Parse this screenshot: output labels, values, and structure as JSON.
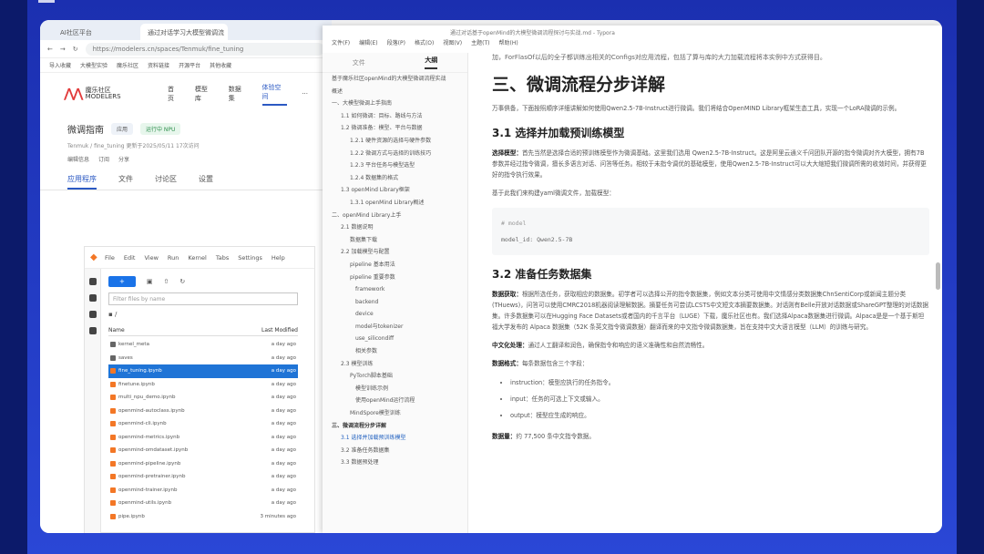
{
  "browser": {
    "tabs": [
      "AI社区平台",
      "通过对话学习大模型微调流"
    ],
    "url": "https://modelers.cn/spaces/Tenmuk/fine_tuning",
    "bookmarks": [
      "导入收藏",
      "大模型实验",
      "魔乐社区",
      "资料链接",
      "开源平台",
      "其他收藏"
    ]
  },
  "site": {
    "logo_text": "魔乐社区 MODELERS",
    "nav": [
      "首页",
      "模型库",
      "数据集",
      "体验空间",
      "···"
    ],
    "space": {
      "title": "微调指南",
      "tags": [
        "应用",
        "运行中 NPU"
      ],
      "meta": "Tenmuk / fine_tuning   更新于2025/05/11   17次访问",
      "tools": [
        "编辑信息",
        "订阅",
        "分享"
      ]
    },
    "subnav": [
      "应用程序",
      "文件",
      "讨论区",
      "设置"
    ]
  },
  "jupyter": {
    "menu": [
      "File",
      "Edit",
      "View",
      "Run",
      "Kernel",
      "Tabs",
      "Settings",
      "Help"
    ],
    "new_button": "+",
    "filter_placeholder": "Filter files by name",
    "path": "/",
    "col_name": "Name",
    "col_modified": "Last Modified",
    "files": [
      {
        "name": "kernel_meta",
        "time": "a day ago",
        "type": "folder"
      },
      {
        "name": "saves",
        "time": "a day ago",
        "type": "folder"
      },
      {
        "name": "fine_tuning.ipynb",
        "time": "a day ago",
        "type": "nb"
      },
      {
        "name": "finetune.ipynb",
        "time": "a day ago",
        "type": "nb"
      },
      {
        "name": "multi_npu_demo.ipynb",
        "time": "a day ago",
        "type": "nb"
      },
      {
        "name": "openmind-autoclass.ipynb",
        "time": "a day ago",
        "type": "nb"
      },
      {
        "name": "openmind-cli.ipynb",
        "time": "a day ago",
        "type": "nb"
      },
      {
        "name": "openmind-metrics.ipynb",
        "time": "a day ago",
        "type": "nb"
      },
      {
        "name": "openmind-omdataset.ipynb",
        "time": "a day ago",
        "type": "nb"
      },
      {
        "name": "openmind-pipeline.ipynb",
        "time": "a day ago",
        "type": "nb"
      },
      {
        "name": "openmind-pretrainer.ipynb",
        "time": "a day ago",
        "type": "nb"
      },
      {
        "name": "openmind-trainer.ipynb",
        "time": "a day ago",
        "type": "nb"
      },
      {
        "name": "openmind-utils.ipynb",
        "time": "a day ago",
        "type": "nb"
      },
      {
        "name": "pipe.ipynb",
        "time": "3 minutes ago",
        "type": "nb"
      }
    ]
  },
  "typora": {
    "title": "通过对话基于openMind的大模型微调流程探讨与实战.md - Typora",
    "menu": [
      "文件(F)",
      "编辑(E)",
      "段落(P)",
      "格式(O)",
      "视图(V)",
      "主题(T)",
      "帮助(H)"
    ],
    "outline_tabs": [
      "文件",
      "大纲"
    ],
    "outline": [
      {
        "t": "基于魔乐社区openMind的大模型微调流程实战",
        "l": "l1"
      },
      {
        "t": "概述",
        "l": "l1"
      },
      {
        "t": "一、大模型微调上手指南",
        "l": "l1"
      },
      {
        "t": "1.1 如何微调：目标、路线与方法",
        "l": "l2"
      },
      {
        "t": "1.2 微调准备：模型、平台与数据",
        "l": "l2"
      },
      {
        "t": "1.2.1 硬件资源的选择与硬件参数",
        "l": "l3"
      },
      {
        "t": "1.2.2 微调方式与选择的训练技巧",
        "l": "l3"
      },
      {
        "t": "1.2.3 平台任务与模型选型",
        "l": "l3"
      },
      {
        "t": "1.2.4 数据集的格式",
        "l": "l3"
      },
      {
        "t": "1.3 openMind Library框架",
        "l": "l2"
      },
      {
        "t": "1.3.1 openMind Library概述",
        "l": "l3"
      },
      {
        "t": "二、openMind Library上手",
        "l": "l1"
      },
      {
        "t": "2.1 数据说明",
        "l": "l2"
      },
      {
        "t": "数据集下载",
        "l": "l3"
      },
      {
        "t": "2.2 加载模型与配置",
        "l": "l2"
      },
      {
        "t": "pipeline 基本用法",
        "l": "l3"
      },
      {
        "t": "pipeline 重要参数",
        "l": "l3"
      },
      {
        "t": "framework",
        "l": "l4"
      },
      {
        "t": "backend",
        "l": "l4"
      },
      {
        "t": "device",
        "l": "l4"
      },
      {
        "t": "model与tokenizer",
        "l": "l4"
      },
      {
        "t": "use_silicondiff",
        "l": "l4"
      },
      {
        "t": "相关参数",
        "l": "l4"
      },
      {
        "t": "2.3 模型训练",
        "l": "l2"
      },
      {
        "t": "PyTorch脚本基础",
        "l": "l3"
      },
      {
        "t": "模型训练示例",
        "l": "l4"
      },
      {
        "t": "使用openMind运行流程",
        "l": "l4"
      },
      {
        "t": "MindSpore模型训练",
        "l": "l3"
      },
      {
        "t": "三、微调流程分步详解",
        "l": "l1 bold"
      },
      {
        "t": "3.1 选择并加载预训练模型",
        "l": "l2 cur"
      },
      {
        "t": "3.2 准备任务数据集",
        "l": "l2"
      },
      {
        "t": "3.3 数据预处理",
        "l": "l2"
      }
    ],
    "doc": {
      "topline": "加，ForFlasOf以后的全子都训练出相关的Configs对应用流程，包括了算与库的大力加载流程将本实例中方式获得目。",
      "h2": "三、微调流程分步详解",
      "p1": "万事俱备，下面按照顺序详细讲解如何使用Qwen2.5-7B-Instruct进行微调。我们将结合OpenMIND Library框架生态工具，实现一个LoRA微调的示例。",
      "h3_1": "3.1 选择并加载预训练模型",
      "p2_label": "选择模型：",
      "p2": "首先当然是选择合适的预训练模型作为微调基础。这里我们选用 Qwen2.5-7B-Instruct。这是阿里云通义千问团队开源的指令微调对齐大模型，拥有7B参数并经过指令微调，擅长多语言对话、问答等任务。相较于未指令调优的基础模型，使用Qwen2.5-7B-Instruct可以大大缩短我们微调所需的收敛时间，并获得更好的指令执行效果。",
      "p3": "基于此我们来构建yaml微调文件，加载模型：",
      "code_comment": "# model",
      "code_line": "model_id: Qwen2.5-7B",
      "h3_2": "3.2 准备任务数据集",
      "p4_label": "数据获取：",
      "p4": "根据所选任务，获取相应的数据集。初学者可以选择公开的指令数据集，例如文本分类可使用中文情感分类数据集ChnSentiCorp或新闻主题分类(THuews)，问答可以使用CMRC2018机器阅读理解数据。摘要任务可尝试LCSTS中文短文本摘要数据集。对话则有Belle开放对话数据或ShareGPT整理的对话数据集。许多数据集可以在Hugging Face Datasets或者国内的千言平台（LUGE）下载，魔乐社区也有。我们选择Alpaca数据集进行微调。Alpaca是是一个基于斯坦福大学发布的 Alpaca 数据集（52K 条英文指令微调数据）翻译而来的中文指令微调数据集，旨在支持中文大语言模型（LLM）的训练与研究。",
      "p5_label": "中文化处理：",
      "p5": "通过人工翻译和润色，确保指令和响应的语义准确性和自然流畅性。",
      "p6_label": "数据格式：",
      "p6": "每条数据包含三个字段：",
      "bullets": [
        "instruction：模型应执行的任务指令。",
        "input：任务的可选上下文或输入。",
        "output：模型应生成的响应。"
      ],
      "p7_label": "数据量：",
      "p7": "约 77,500 条中文指令数据。"
    }
  }
}
